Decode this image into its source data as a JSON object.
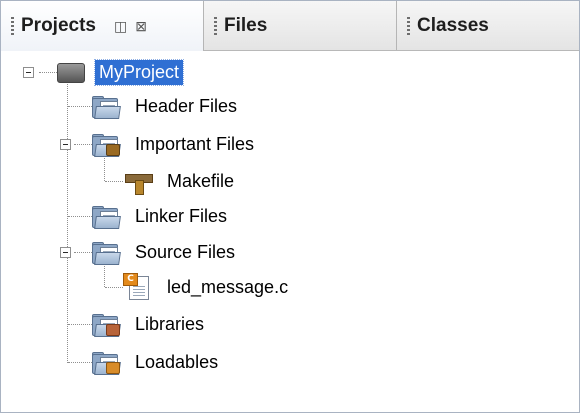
{
  "tabs": [
    {
      "label": "Projects",
      "active": true,
      "controls": [
        "◫",
        "⊠"
      ]
    },
    {
      "label": "Files",
      "active": false
    },
    {
      "label": "Classes",
      "active": false
    }
  ],
  "tree": {
    "root": {
      "label": "MyProject",
      "icon": "chip-icon",
      "selected": true,
      "expanded": true
    },
    "items": [
      {
        "label": "Header Files",
        "icon": "header-folder-icon",
        "level": 1
      },
      {
        "label": "Important Files",
        "icon": "important-folder-icon",
        "level": 1,
        "expanded": true
      },
      {
        "label": "Makefile",
        "icon": "makefile-icon",
        "level": 2
      },
      {
        "label": "Linker Files",
        "icon": "linker-folder-icon",
        "level": 1
      },
      {
        "label": "Source Files",
        "icon": "source-folder-icon",
        "level": 1,
        "expanded": true
      },
      {
        "label": "led_message.c",
        "icon": "c-file-icon",
        "level": 2
      },
      {
        "label": "Libraries",
        "icon": "libraries-folder-icon",
        "level": 1
      },
      {
        "label": "Loadables",
        "icon": "loadables-folder-icon",
        "level": 1
      }
    ]
  },
  "colors": {
    "selection": "#2f6fd3",
    "folder": "#8ea7c6",
    "background": "#ffffff"
  }
}
